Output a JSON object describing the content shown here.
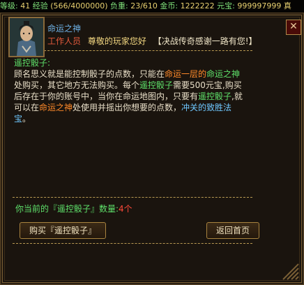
{
  "status_bar": {
    "level_label": "等级:",
    "level_value": "41",
    "exp_label": "经验",
    "exp_value": "(566/4000000)",
    "load_label": "负重:",
    "load_value": "23/610",
    "gold_label": "金币:",
    "gold_value": "1222222",
    "yuanbao_label": "元宝:",
    "yuanbao_value": "999997999",
    "extra_value": "真"
  },
  "dialog": {
    "close_label": "✕",
    "npc_name": "命运之神",
    "staff_label": "工作人员",
    "greeting": "尊敬的玩家您好",
    "motto": "【决战传奇感谢一路有您!】",
    "item_title": "遥控骰子:",
    "desc_1a": "顾名思义就是能控制骰子的点数，只能在",
    "desc_1b": "命运一层的",
    "desc_1c": "命运之神",
    "desc_1d": "处购买，其它地方无法购买。每个",
    "desc_1e": "遥控骰子",
    "desc_1f": "需要500元宝,购买后存在于你的账号中，当你在命运地图内，只要有",
    "desc_1g": "遥控骰子",
    "desc_1h": ",就可以在",
    "desc_1i": "命运之神",
    "desc_1j": "处使用并摇出你想要的点数，",
    "desc_1k": "冲关的致胜法宝",
    "desc_1l": "。",
    "count_prefix": "你当前的『遥控骰子』数量:",
    "count_value": "4个",
    "buy_button": "购买『遥控骰子』",
    "home_button": "返回首页"
  }
}
